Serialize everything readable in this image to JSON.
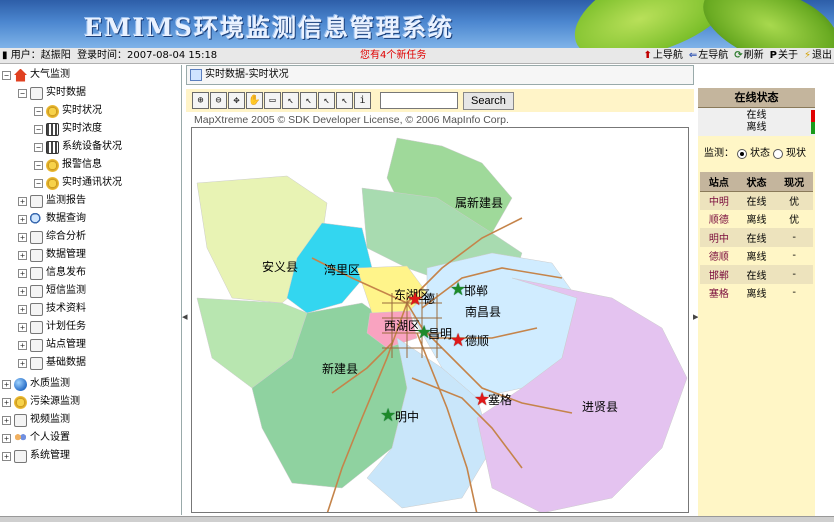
{
  "banner": {
    "title": "EMIMS环境监测信息管理系统"
  },
  "statusbar": {
    "user_label": "用户：赵振阳",
    "login_label": "登录时间：2007-08-04 15:18",
    "task_notice": "您有4个新任务",
    "nav": {
      "up": "上导航",
      "left": "左导航",
      "refresh": "刷新",
      "about": "关于",
      "exit": "退出"
    }
  },
  "sidebar": {
    "items": [
      {
        "label": "大气监测",
        "icon": "home-icon"
      },
      {
        "label": "实时数据",
        "icon": "doc-icon"
      },
      {
        "label": "实时状况",
        "icon": "gear-icon"
      },
      {
        "label": "实时浓度",
        "icon": "grid-icon"
      },
      {
        "label": "系统设备状况",
        "icon": "grid-icon"
      },
      {
        "label": "报警信息",
        "icon": "gear-icon"
      },
      {
        "label": "实时通讯状况",
        "icon": "gear-icon"
      },
      {
        "label": "监测报告",
        "icon": "doc-icon"
      },
      {
        "label": "数据查询",
        "icon": "search-icon"
      },
      {
        "label": "综合分析",
        "icon": "doc-icon"
      },
      {
        "label": "数据管理",
        "icon": "doc-icon"
      },
      {
        "label": "信息发布",
        "icon": "doc-icon"
      },
      {
        "label": "短信监测",
        "icon": "doc-icon"
      },
      {
        "label": "技术资料",
        "icon": "doc-icon"
      },
      {
        "label": "计划任务",
        "icon": "doc-icon"
      },
      {
        "label": "站点管理",
        "icon": "doc-icon"
      },
      {
        "label": "基础数据",
        "icon": "doc-icon"
      },
      {
        "label": "水质监测",
        "icon": "globe-icon"
      },
      {
        "label": "污染源监测",
        "icon": "gear-icon"
      },
      {
        "label": "视频监测",
        "icon": "doc-icon"
      },
      {
        "label": "个人设置",
        "icon": "people-icon"
      },
      {
        "label": "系统管理",
        "icon": "doc-icon"
      }
    ]
  },
  "main": {
    "breadcrumb": "实时数据-实时状况",
    "search_button": "Search",
    "search_value": "",
    "copyright": "MapXtreme 2005 © SDK Developer License, © 2006 MapInfo Corp."
  },
  "map": {
    "regions": [
      "属新建县",
      "安义县",
      "湾里区",
      "东湖区",
      "南昌县",
      "西湖区",
      "新建县",
      "进贤县"
    ],
    "stations": [
      "邯郸",
      "德",
      "昌明",
      "德顺",
      "塞格",
      "明中"
    ]
  },
  "rightpanel": {
    "title": "在线状态",
    "legend_online": "在线",
    "legend_offline": "离线",
    "monitor_label": "监测：",
    "option_status": "状态",
    "option_current": "现状",
    "headers": [
      "站点",
      "状态",
      "现况"
    ],
    "rows": [
      [
        "中明",
        "在线",
        "优"
      ],
      [
        "顺德",
        "离线",
        "优"
      ],
      [
        "明中",
        "在线",
        "-"
      ],
      [
        "德顺",
        "离线",
        "-"
      ],
      [
        "邯郸",
        "在线",
        "-"
      ],
      [
        "塞格",
        "离线",
        "-"
      ]
    ]
  },
  "colors": {
    "accent": "#2d5ea8",
    "online": "#1a9a1a",
    "offline": "#e00000",
    "panel_bg": "#fff6c6",
    "panel_header": "#c4b59d"
  }
}
